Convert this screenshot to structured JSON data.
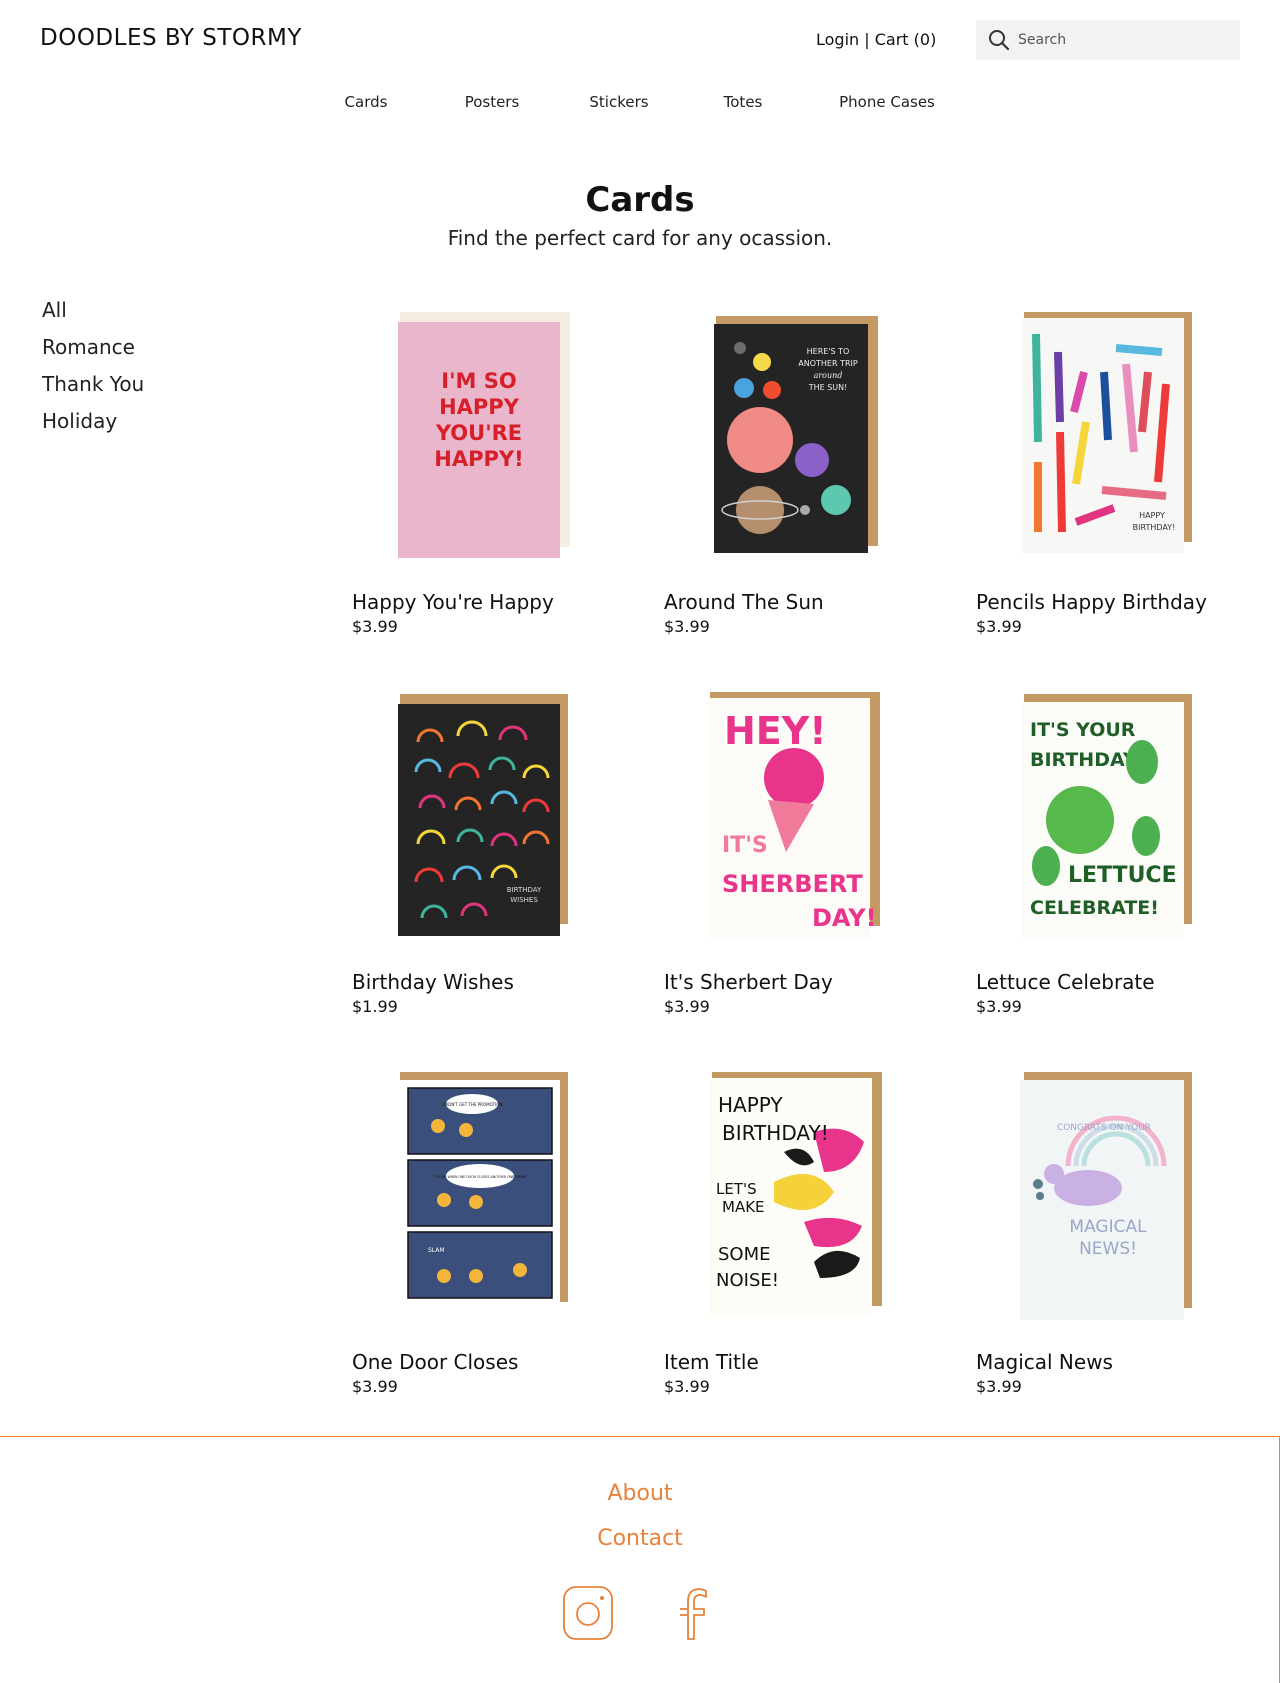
{
  "header": {
    "brand": "DOODLES BY STORMY",
    "login": "Login",
    "separator": " | ",
    "cart": "Cart (0)",
    "search_placeholder": "Search"
  },
  "nav": [
    "Cards",
    "Posters",
    "Stickers",
    "Totes",
    "Phone Cases"
  ],
  "page": {
    "title": "Cards",
    "subtitle": "Find the perfect card for any ocassion."
  },
  "sidebar": [
    "All",
    "Romance",
    "Thank You",
    "Holiday"
  ],
  "products": [
    {
      "name": "Happy You're Happy",
      "price": "$3.99",
      "card_text": [
        "I'M SO",
        "HAPPY",
        "YOU'RE",
        "HAPPY!"
      ]
    },
    {
      "name": "Around The Sun",
      "price": "$3.99",
      "card_text": [
        "HERE'S TO",
        "ANOTHER TRIP",
        "around",
        "THE SUN!"
      ]
    },
    {
      "name": "Pencils Happy Birthday",
      "price": "$3.99",
      "card_text": [
        "HAPPY",
        "BIRTHDAY!"
      ]
    },
    {
      "name": "Birthday Wishes",
      "price": "$1.99",
      "card_text": [
        "BIRTHDAY",
        "WISHES"
      ]
    },
    {
      "name": "It's Sherbert Day",
      "price": "$3.99",
      "card_text": [
        "HEY!",
        "IT'S",
        "SHERBERT",
        "DAY!"
      ]
    },
    {
      "name": "Lettuce Celebrate",
      "price": "$3.99",
      "card_text": [
        "IT'S YOUR",
        "BIRTHDAY!",
        "LETTUCE",
        "CELEBRATE!"
      ]
    },
    {
      "name": "One Door Closes",
      "price": "$3.99",
      "card_text": [
        "I DIDN'T GET THE PROMOTION",
        "IT'S OK, WHEN ONE DOOR CLOSES ANOTHER ONE OPENS",
        "SLAM"
      ]
    },
    {
      "name": "Item Title",
      "price": "$3.99",
      "card_text": [
        "HAPPY",
        "BIRTHDAY!",
        "LET'S",
        "MAKE",
        "SOME",
        "NOISE!"
      ]
    },
    {
      "name": "Magical News",
      "price": "$3.99",
      "card_text": [
        "CONGRATS ON YOUR",
        "MAGICAL",
        "NEWS!"
      ]
    }
  ],
  "footer": {
    "about": "About",
    "contact": "Contact",
    "social": [
      "instagram-icon",
      "facebook-icon"
    ]
  },
  "colors": {
    "accent": "#e8823a",
    "search_bg": "#f2f2f2",
    "envelope": "#c49a64"
  }
}
